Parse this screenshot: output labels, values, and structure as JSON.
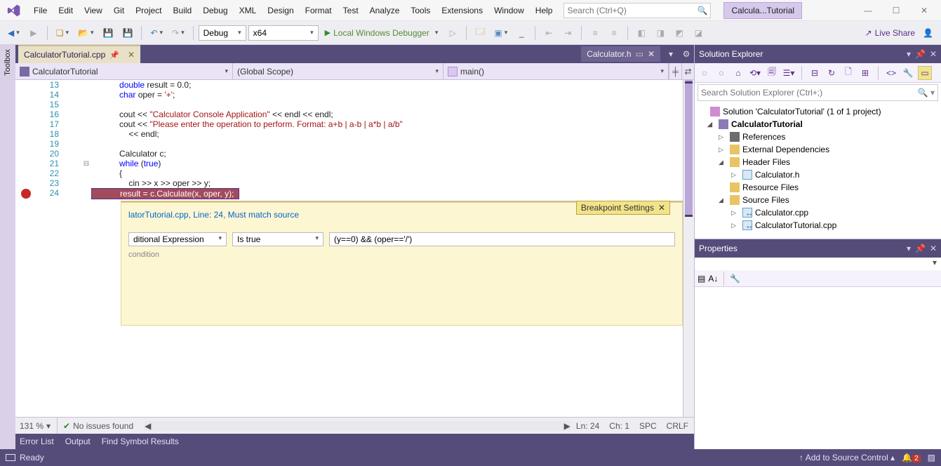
{
  "menus": [
    "File",
    "Edit",
    "View",
    "Git",
    "Project",
    "Build",
    "Debug",
    "XML",
    "Design",
    "Format",
    "Test",
    "Analyze",
    "Tools",
    "Extensions",
    "Window",
    "Help"
  ],
  "search_placeholder": "Search (Ctrl+Q)",
  "title_chip": "Calcula...Tutorial",
  "toolbar": {
    "config": "Debug",
    "platform": "x64",
    "run": "Local Windows Debugger",
    "live_share": "Live Share"
  },
  "toolbox_label": "Toolbox",
  "tabs": {
    "active": "CalculatorTutorial.cpp",
    "right": "Calculator.h"
  },
  "navbar": {
    "class": "CalculatorTutorial",
    "scope": "(Global Scope)",
    "func": "main()"
  },
  "code": [
    {
      "n": 13,
      "html": "<span class='type'>double</span> result = 0.0;"
    },
    {
      "n": 14,
      "html": "<span class='type'>char</span> oper = <span class='ch'>'+'</span>;"
    },
    {
      "n": 15,
      "html": ""
    },
    {
      "n": 16,
      "html": "cout &lt;&lt; <span class='str'>\"Calculator Console Application\"</span> &lt;&lt; endl &lt;&lt; endl;"
    },
    {
      "n": 17,
      "html": "cout &lt;&lt; <span class='str'>\"Please enter the operation to perform. Format: a+b | a-b | a*b | a/b\"</span>"
    },
    {
      "n": 18,
      "html": "    &lt;&lt; endl;"
    },
    {
      "n": 19,
      "html": ""
    },
    {
      "n": 20,
      "html": "Calculator c;"
    },
    {
      "n": 21,
      "html": "<span class='kw'>while</span> (<span class='bool'>true</span>)",
      "fold": true
    },
    {
      "n": 22,
      "html": "{"
    },
    {
      "n": 23,
      "html": "    cin &gt;&gt; x &gt;&gt; oper &gt;&gt; y;"
    },
    {
      "n": 24,
      "html": "    result = c.Calculate(x, oper, y);",
      "hit": true
    }
  ],
  "bp": {
    "title": "Breakpoint Settings",
    "link": "latorTutorial.cpp, Line: 24, Must match source",
    "sel1": "ditional Expression",
    "sel2": "Is true",
    "expr": "(y==0) && (oper=='/')",
    "hint": "condition"
  },
  "editor_status": {
    "zoom": "131 %",
    "issues": "No issues found",
    "ln": "Ln: 24",
    "ch": "Ch: 1",
    "spc": "SPC",
    "crlf": "CRLF"
  },
  "out_tabs": [
    "Error List",
    "Output",
    "Find Symbol Results"
  ],
  "se": {
    "title": "Solution Explorer",
    "search": "Search Solution Explorer (Ctrl+;)",
    "sln": "Solution 'CalculatorTutorial' (1 of 1 project)",
    "prj": "CalculatorTutorial",
    "refs": "References",
    "ext": "External Dependencies",
    "hdr": "Header Files",
    "calc_h": "Calculator.h",
    "res": "Resource Files",
    "src": "Source Files",
    "calc_cpp": "Calculator.cpp",
    "tut_cpp": "CalculatorTutorial.cpp"
  },
  "props_title": "Properties",
  "status": {
    "ready": "Ready",
    "src": "Add to Source Control",
    "notif": "2"
  }
}
